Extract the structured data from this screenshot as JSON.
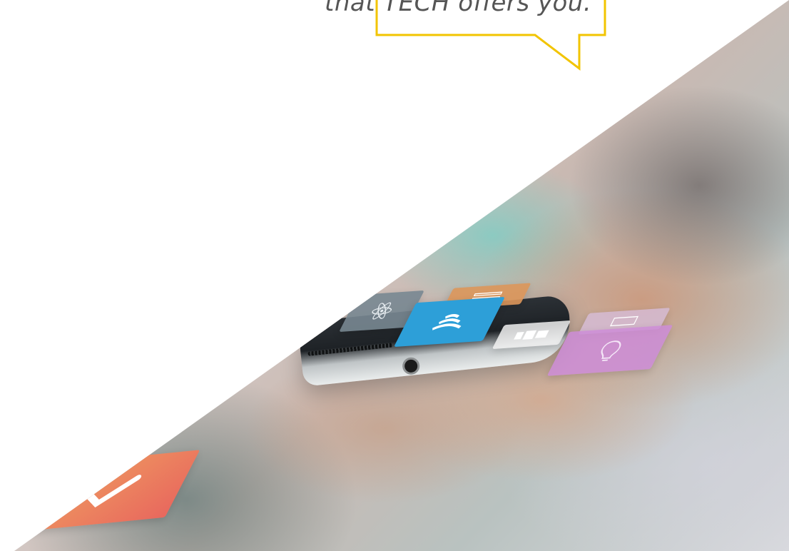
{
  "callout": {
    "text": "that TECH offers you.",
    "border_color": "#f2c400"
  },
  "photo": {
    "description_icons": [
      "atom-icon",
      "wifi-icon",
      "bars-icon",
      "lightbulb-icon",
      "check-icon"
    ],
    "accent_colors": {
      "wifi_tile": "#2d9fd8",
      "purple_tile": "#cd8cd7",
      "coral_tile": "#e8685e",
      "orange_tile": "#dc965a"
    }
  }
}
